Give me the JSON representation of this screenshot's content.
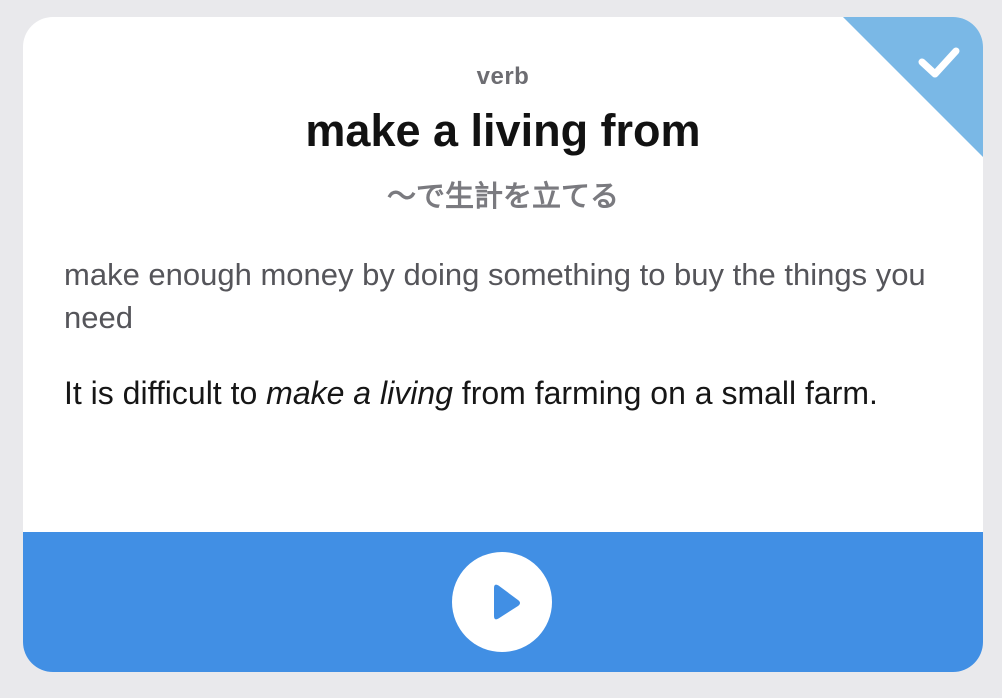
{
  "card": {
    "part_of_speech": "verb",
    "term": "make a living from",
    "translation": "～で生計を立てる",
    "definition": "make enough money by doing something to buy the things you need",
    "example": {
      "before": "It is difficult to ",
      "highlight": "make a living",
      "after": " from farming on a small farm."
    },
    "status": {
      "icon": "checkmark-icon",
      "state": "checked",
      "color": "#7ab8e6"
    }
  },
  "footer": {
    "color": "#418fe4",
    "play_icon": "play-icon"
  }
}
